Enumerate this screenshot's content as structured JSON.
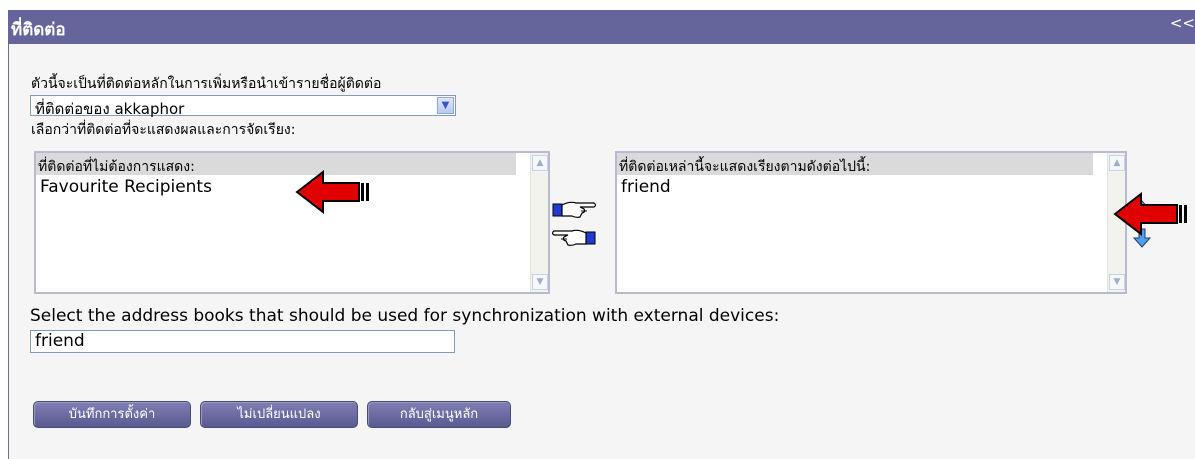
{
  "header": {
    "title": "ที่ติดต่อ",
    "collapse_label": "<<"
  },
  "intro_label": "ตัวนี้จะเป็นที่ติดต่อหลักในการเพิ่มหรือนำเข้ารายชื่อผู้ติดต่อ",
  "default_book": {
    "value": "ที่ติดต่อของ akkaphor",
    "arrow": "chevron-down-icon"
  },
  "display_label": "เลือกว่าที่ติดต่อที่จะแสดงผลและการจัดเรียง:",
  "hidden_list": {
    "header": "ที่ติดต่อที่ไม่ต้องการแสดง:",
    "items": [
      "Favourite Recipients"
    ]
  },
  "shown_list": {
    "header": "ที่ติดต่อเหล่านี้จะแสดงเรียงตามดังต่อไปนี้:",
    "items": [
      "friend"
    ]
  },
  "sync_label": "Select the address books that should be used for synchronization with external devices:",
  "sync_input": {
    "value": "friend"
  },
  "buttons": {
    "save": "บันทึกการตั้งค่า",
    "cancel": "ไม่เปลี่ยนแปลง",
    "back": "กลับสู่เมนูหลัก"
  },
  "colors": {
    "header_bg": "#65659c",
    "annotation_arrow": "#e00000",
    "button_bg": "#6b6ba3"
  }
}
